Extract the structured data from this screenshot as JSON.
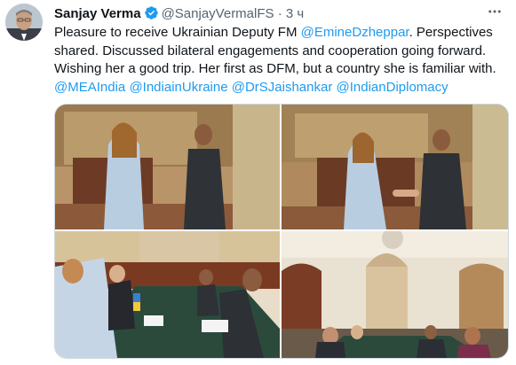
{
  "author": {
    "name": "Sanjay Verma",
    "handle": "@SanjayVermalFS",
    "separator": "·",
    "time": "3 ч",
    "verified_color": "#1d9bf0"
  },
  "tweet": {
    "segments": [
      {
        "text": "Pleasure to receive Ukrainian Deputy FM ",
        "type": "text"
      },
      {
        "text": "@EmineDzheppar",
        "type": "mention"
      },
      {
        "text": ". Perspectives shared. Discussed bilateral engagements and cooperation going forward. Wishing her a good trip. Her first as DFM, but a country she is familiar with. ",
        "type": "text"
      },
      {
        "text": "@MEAIndia",
        "type": "mention"
      },
      {
        "text": " ",
        "type": "text"
      },
      {
        "text": "@IndiainUkraine",
        "type": "mention"
      },
      {
        "text": " ",
        "type": "text"
      },
      {
        "text": "@DrSJaishankar",
        "type": "mention"
      },
      {
        "text": " ",
        "type": "text"
      },
      {
        "text": "@IndianDiplomacy",
        "type": "mention"
      }
    ]
  },
  "media": {
    "photo_count": 4
  },
  "colors": {
    "mention": "#1d9bf0",
    "secondary_text": "#536471",
    "border": "#cfd9de"
  }
}
